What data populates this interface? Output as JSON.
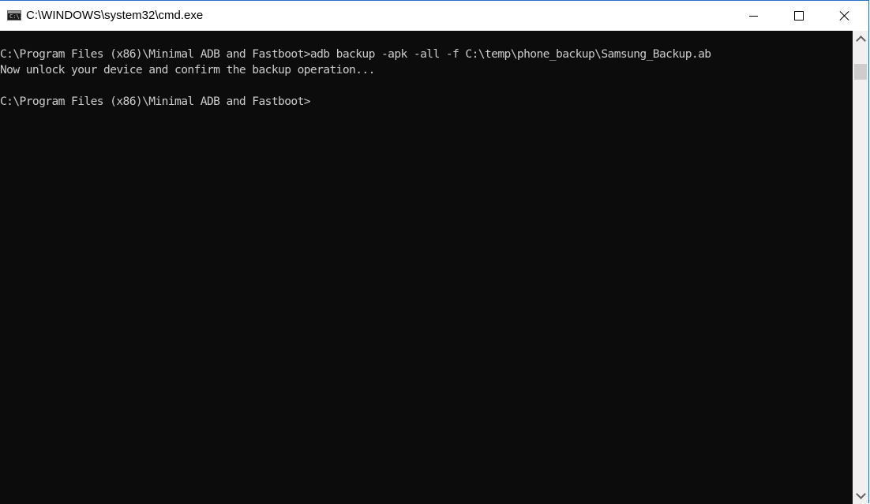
{
  "window": {
    "title": "C:\\WINDOWS\\system32\\cmd.exe",
    "icon": "cmd-icon",
    "icon_text": "C:\\."
  },
  "controls": {
    "minimize": "minimize-icon",
    "maximize": "maximize-icon",
    "close": "close-icon"
  },
  "console": {
    "lines": [
      "C:\\Program Files (x86)\\Minimal ADB and Fastboot>adb backup -apk -all -f C:\\temp\\phone_backup\\Samsung_Backup.ab",
      "Now unlock your device and confirm the backup operation...",
      "",
      "C:\\Program Files (x86)\\Minimal ADB and Fastboot>"
    ],
    "colors": {
      "background": "#0c0c0c",
      "text": "#cccccc"
    }
  },
  "scrollbar": {
    "up": "chevron-up-icon",
    "down": "chevron-down-icon"
  }
}
